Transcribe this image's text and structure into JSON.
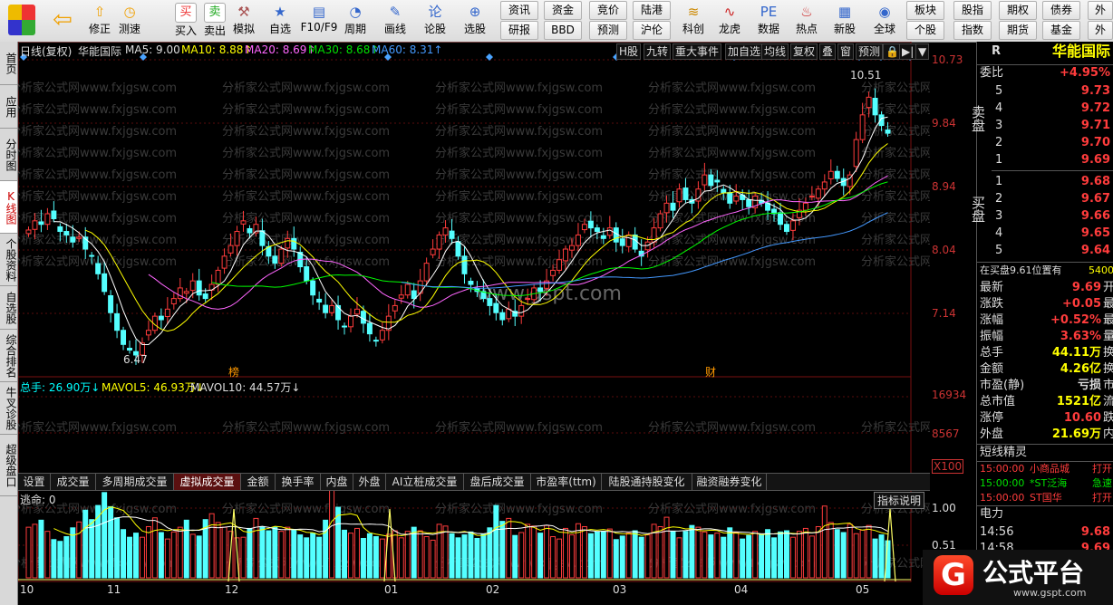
{
  "toolbar": {
    "buttons": [
      {
        "label": "修正",
        "icon": "up-icon"
      },
      {
        "label": "测速",
        "icon": "clock-icon"
      },
      {
        "label": "买入",
        "icon": "buy-icon",
        "glyph": "买"
      },
      {
        "label": "卖出",
        "icon": "sell-icon",
        "glyph": "卖"
      },
      {
        "label": "模拟",
        "icon": "hammer-icon"
      },
      {
        "label": "自选",
        "icon": "star-icon"
      },
      {
        "label": "F10/F9",
        "icon": "f10-icon"
      },
      {
        "label": "周期",
        "icon": "period-icon"
      },
      {
        "label": "画线",
        "icon": "pen-icon"
      },
      {
        "label": "论股",
        "icon": "discuss-icon",
        "glyph": "论"
      },
      {
        "label": "选股",
        "icon": "search-icon"
      },
      {
        "label": "科创",
        "icon": "kechuang-icon"
      },
      {
        "label": "龙虎",
        "icon": "dragon-icon"
      },
      {
        "label": "数据",
        "icon": "pe-icon",
        "glyph": "PE"
      },
      {
        "label": "热点",
        "icon": "hot-icon"
      },
      {
        "label": "新股",
        "icon": "newstock-icon"
      },
      {
        "label": "全球",
        "icon": "globe-icon"
      }
    ],
    "small_buttons": [
      [
        "资讯",
        "研报"
      ],
      [
        "资金",
        "BBD"
      ],
      [
        "竞价",
        "预测"
      ],
      [
        "陆港",
        "沪伦"
      ],
      [
        "板块",
        "个股"
      ],
      [
        "股指",
        "指数"
      ],
      [
        "期权",
        "期货"
      ],
      [
        "债券",
        "基金"
      ],
      [
        "外",
        "外"
      ]
    ]
  },
  "leftnav": [
    "首页",
    "应用",
    "分时图",
    "K线图",
    "个股资料",
    "自选股",
    "综合排名",
    "牛叉诊股",
    "超级盘口"
  ],
  "chart_header": {
    "period": "日线(复权)",
    "name": "华能国际",
    "ma5": "MA5: 9.00",
    "ma10": "MA10: 8.88↑",
    "ma20": "MA20: 8.69↑",
    "ma30": "MA30: 8.68↑",
    "ma60": "MA60: 8.31↑",
    "tags": [
      "H股",
      "九转",
      "重大事件",
      "加自选",
      "均线",
      "复权",
      "叠",
      "窗",
      "预测"
    ]
  },
  "price_axis": [
    "10.73",
    "9.84",
    "8.94",
    "8.04",
    "7.14"
  ],
  "annotations": {
    "high": "10.51",
    "low": "6.47",
    "mark1": "榜",
    "mark2": "财"
  },
  "volume_header": {
    "total": "总手: 26.90万↓",
    "mavol5": "MAVOL5: 46.93万↓",
    "mavol10": "MAVOL10: 44.57万↓"
  },
  "volume_axis": [
    "16934",
    "8567",
    "X100"
  ],
  "indicator_tabs": [
    "设置",
    "成交量",
    "多周期成交量",
    "虚拟成交量",
    "金额",
    "换手率",
    "内盘",
    "外盘",
    "AI立桩成交量",
    "盘后成交量",
    "市盈率(ttm)",
    "陆股通持股变化",
    "融资融券变化"
  ],
  "indicator_active": "虚拟成交量",
  "escape_label": "逃命: 0",
  "indicator_help": "指标说明",
  "escape_axis": [
    "1.00",
    "0.51"
  ],
  "date_axis": [
    "10",
    "11",
    "12",
    "01",
    "02",
    "03",
    "04",
    "05"
  ],
  "watermark": "分析家公式网www.fxjgsw.com",
  "center_watermark": "www.gspt.com",
  "right_panel": {
    "code_flag": "R",
    "name": "华能国际",
    "weibi_label": "委比",
    "weibi_value": "+4.95%",
    "sell_label": "卖盘",
    "buy_label": "买盘",
    "sell": [
      {
        "level": "5",
        "price": "9.73"
      },
      {
        "level": "4",
        "price": "9.72"
      },
      {
        "level": "3",
        "price": "9.71"
      },
      {
        "level": "2",
        "price": "9.70"
      },
      {
        "level": "1",
        "price": "9.69"
      }
    ],
    "buy": [
      {
        "level": "1",
        "price": "9.68"
      },
      {
        "level": "2",
        "price": "9.67"
      },
      {
        "level": "3",
        "price": "9.66"
      },
      {
        "level": "4",
        "price": "9.65"
      },
      {
        "level": "5",
        "price": "9.64"
      }
    ],
    "position_note": "在买盘9.61位置有",
    "position_value": "5400",
    "stats": [
      {
        "label": "最新",
        "value": "9.69",
        "extra": "开"
      },
      {
        "label": "涨跌",
        "value": "+0.05",
        "extra": "最"
      },
      {
        "label": "涨幅",
        "value": "+0.52%",
        "extra": "最"
      },
      {
        "label": "振幅",
        "value": "3.63%",
        "extra": "量"
      },
      {
        "label": "总手",
        "value": "44.11万",
        "extra": "换"
      },
      {
        "label": "金额",
        "value": "4.26亿",
        "extra": "换"
      },
      {
        "label": "市盈(静)",
        "value": "亏损",
        "extra": "市"
      },
      {
        "label": "总市值",
        "value": "1521亿",
        "extra": "流"
      },
      {
        "label": "涨停",
        "value": "10.60",
        "extra": "跌"
      },
      {
        "label": "外盘",
        "value": "21.69万",
        "extra": "内"
      }
    ],
    "sprite_title": "短线精灵",
    "sprites": [
      {
        "time": "15:00:00",
        "name": "小商品城",
        "action": "打开"
      },
      {
        "time": "15:00:00",
        "name": "*ST泛海",
        "action": "急速"
      },
      {
        "time": "15:00:00",
        "name": "ST国华",
        "action": "打开"
      }
    ],
    "sector": "电力",
    "ticks": [
      {
        "time": "14:56",
        "price": "9.68"
      },
      {
        "time": "14:58",
        "price": "9.69"
      }
    ]
  },
  "logo": {
    "text": "公式平台",
    "url": "www.gspt.com"
  },
  "colors": {
    "up": "#ff3c3c",
    "down": "#54ffff",
    "ma5": "#ffffff",
    "ma10": "#ffff00",
    "ma20": "#ff66ff",
    "ma30": "#00ff00",
    "ma60": "#4499ff",
    "bg": "#000000"
  },
  "chart_data": {
    "type": "candlestick",
    "ylim": [
      6.3,
      10.85
    ],
    "ohlc_series_note": "daily candles Oct-May",
    "close": [
      8.32,
      8.45,
      8.4,
      8.55,
      8.48,
      8.3,
      8.25,
      8.15,
      8.22,
      8.05,
      7.95,
      7.7,
      7.45,
      7.15,
      6.9,
      6.7,
      6.62,
      6.55,
      6.72,
      6.9,
      7.1,
      7.05,
      7.2,
      7.35,
      7.5,
      7.45,
      7.6,
      7.4,
      7.35,
      7.55,
      7.75,
      7.95,
      8.1,
      8.3,
      8.45,
      8.28,
      8.4,
      8.1,
      7.95,
      7.85,
      8.05,
      8.2,
      8.05,
      7.8,
      7.6,
      7.4,
      7.3,
      7.15,
      7.25,
      7.05,
      6.95,
      7.1,
      7.2,
      7.0,
      6.85,
      6.75,
      6.9,
      7.1,
      7.25,
      7.4,
      7.55,
      7.35,
      7.6,
      7.85,
      8.05,
      8.25,
      8.35,
      8.2,
      7.95,
      7.7,
      7.55,
      7.45,
      7.35,
      7.25,
      7.15,
      7.05,
      7.2,
      7.1,
      7.25,
      7.35,
      7.5,
      7.45,
      7.6,
      7.75,
      7.9,
      8.05,
      8.1,
      8.25,
      8.4,
      8.35,
      8.3,
      8.2,
      8.35,
      8.15,
      8.1,
      8.25,
      8.05,
      7.95,
      8.15,
      8.35,
      8.55,
      8.7,
      8.6,
      8.9,
      8.75,
      8.7,
      8.9,
      9.1,
      8.95,
      9.0,
      8.85,
      8.7,
      8.8,
      8.75,
      8.65,
      8.8,
      8.7,
      8.6,
      8.55,
      8.4,
      8.3,
      8.45,
      8.6,
      8.7,
      8.8,
      8.9,
      9.0,
      9.15,
      9.05,
      8.95,
      9.1,
      9.6,
      9.95,
      10.2,
      9.95,
      9.8,
      9.69
    ],
    "volume": [
      8600,
      9100,
      9800,
      7900,
      6500,
      6200,
      7000,
      8500,
      9500,
      11500,
      9900,
      12300,
      14500,
      12100,
      10200,
      8200,
      6900,
      7600,
      6900,
      8700,
      10200,
      7700,
      6600,
      7800,
      8600,
      9800,
      7400,
      7100,
      9900,
      10900,
      9400,
      8600,
      7900,
      6800,
      6900,
      8400,
      10100,
      8700,
      8000,
      8600,
      7900,
      8600,
      8100,
      7300,
      6800,
      7600,
      6900,
      9800,
      16900,
      12000,
      8100,
      7600,
      8400,
      6700,
      7500,
      7000,
      6600,
      7400,
      8000,
      6800,
      7900,
      8600,
      8000,
      7000,
      6400,
      9100,
      8800,
      7500,
      6800,
      7300,
      7800,
      6700,
      7400,
      8500,
      12300,
      9600,
      10100,
      7200,
      7700,
      9100,
      8800,
      7600,
      8900,
      7000,
      6600,
      8400,
      7300,
      9200,
      8700,
      7500,
      7800,
      7900,
      8300,
      6500,
      7100,
      7600,
      8000,
      6900,
      7300,
      9100,
      8700,
      10300,
      7900,
      6800,
      7900,
      8900,
      8600,
      7800,
      7300,
      7600,
      6900,
      8500,
      7700,
      6600,
      7200,
      7900,
      7300,
      8200,
      6800,
      7800,
      8000,
      6900,
      7900,
      8400,
      7100,
      8700,
      12200,
      9400,
      8200,
      7700,
      9100,
      7500,
      8100,
      8900,
      6600,
      7300,
      6300
    ],
    "escape_signals_index": [
      47,
      83,
      198
    ]
  }
}
